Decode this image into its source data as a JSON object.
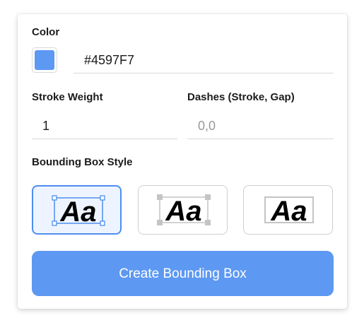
{
  "color": {
    "label": "Color",
    "value": "#4597F7",
    "swatch_hex": "#5d98f2"
  },
  "stroke_weight": {
    "label": "Stroke Weight",
    "value": "1"
  },
  "dashes": {
    "label": "Dashes (Stroke, Gap)",
    "placeholder": "0,0"
  },
  "bounding_box_style": {
    "label": "Bounding Box Style",
    "options": [
      {
        "sample": "Aa",
        "icon": "bbox-with-handles",
        "selected": true
      },
      {
        "sample": "Aa",
        "icon": "bbox-corner-squares",
        "selected": false
      },
      {
        "sample": "Aa",
        "icon": "bbox-plain-frame",
        "selected": false
      }
    ]
  },
  "create_button": {
    "label": "Create Bounding Box"
  },
  "colors": {
    "accent": "#5d98f2",
    "selected_bg": "#eef4ff",
    "border": "#cfcfcf"
  }
}
